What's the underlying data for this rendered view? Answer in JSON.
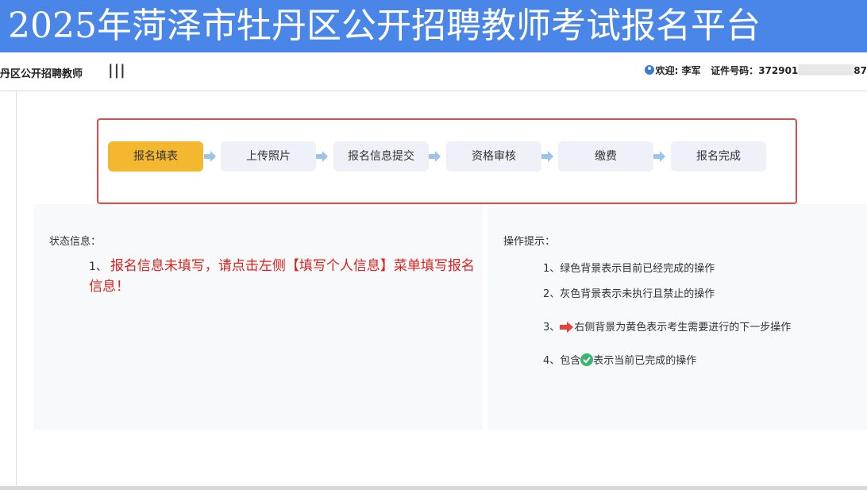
{
  "banner": {
    "title": "2025年菏泽市牡丹区公开招聘教师考试报名平台"
  },
  "header": {
    "system_name": "丹区公开招聘教师",
    "menu_toggle": "|||",
    "welcome_label": "欢迎: 李军",
    "id_label": "证件号码：",
    "id_prefix": "372901",
    "id_suffix": "87"
  },
  "steps": [
    {
      "label": "报名填表",
      "state": "current"
    },
    {
      "label": "上传照片",
      "state": "disabled"
    },
    {
      "label": "报名信息提交",
      "state": "disabled"
    },
    {
      "label": "资格审核",
      "state": "disabled"
    },
    {
      "label": "缴费",
      "state": "disabled"
    },
    {
      "label": "报名完成",
      "state": "disabled"
    }
  ],
  "status_panel": {
    "title": "状态信息：",
    "message_number": "1、",
    "message": "报名信息未填写，请点击左侧【填写个人信息】菜单填写报名信息！"
  },
  "tips_panel": {
    "title": "操作提示：",
    "tips": [
      {
        "number": "1、",
        "text": "绿色背景表示目前已经完成的操作"
      },
      {
        "number": "2、",
        "text": "灰色背景表示未执行且禁止的操作"
      },
      {
        "number": "3、",
        "text": "右侧背景为黄色表示考生需要进行的下一步操作",
        "icon": "red-arrow-icon"
      },
      {
        "number": "4、",
        "text": "包含",
        "text2": "表示当前已完成的操作",
        "icon": "green-check-icon"
      }
    ]
  },
  "colors": {
    "banner": "#4a86e8",
    "current_step": "#f4b730",
    "disabled_step": "#eef1f7",
    "highlight_border": "#e04a48",
    "status_text": "#e0201a"
  }
}
